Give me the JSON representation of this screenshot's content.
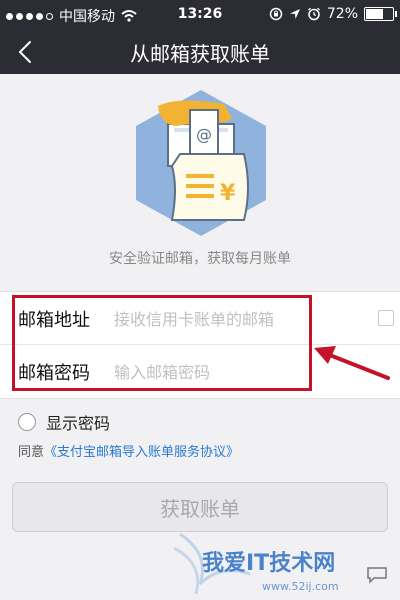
{
  "status_bar": {
    "carrier": "中国移动",
    "time": "13:26",
    "battery": "72%",
    "battery_level": 0.72,
    "icons": [
      "signal-dots-icon",
      "wifi-icon",
      "rotation-lock-icon",
      "location-icon",
      "alarm-icon",
      "battery-icon"
    ]
  },
  "navbar": {
    "title": "从邮箱获取账单",
    "back_icon": "back-chevron-icon"
  },
  "illustration": {
    "name": "mail-bill-illustration",
    "at_symbol": "@",
    "currency": "¥"
  },
  "subtitle": "安全验证邮箱，获取每月账单",
  "form": {
    "email": {
      "label": "邮箱地址",
      "placeholder": "接收信用卡账单的邮箱",
      "value": ""
    },
    "password": {
      "label": "邮箱密码",
      "placeholder": "输入邮箱密码",
      "value": ""
    }
  },
  "show_password": {
    "label": "显示密码",
    "checked": false
  },
  "agreement": {
    "prefix": "同意",
    "link": "《支付宝邮箱导入账单服务协议》"
  },
  "submit_button": {
    "label": "获取账单",
    "enabled": false
  },
  "colors": {
    "navbar_bg": "#2b2c34",
    "page_bg": "#f1f1f3",
    "link": "#2a7bd1",
    "highlight_box": "#c4122a",
    "illustration_hex": "#8fb3dc",
    "illustration_hand": "#f2b233",
    "bill_lines": "#f2b233",
    "watermark": "#2f6fc4"
  },
  "watermark": {
    "text": "我爱IT技术网",
    "url": "www.52ij.com"
  }
}
